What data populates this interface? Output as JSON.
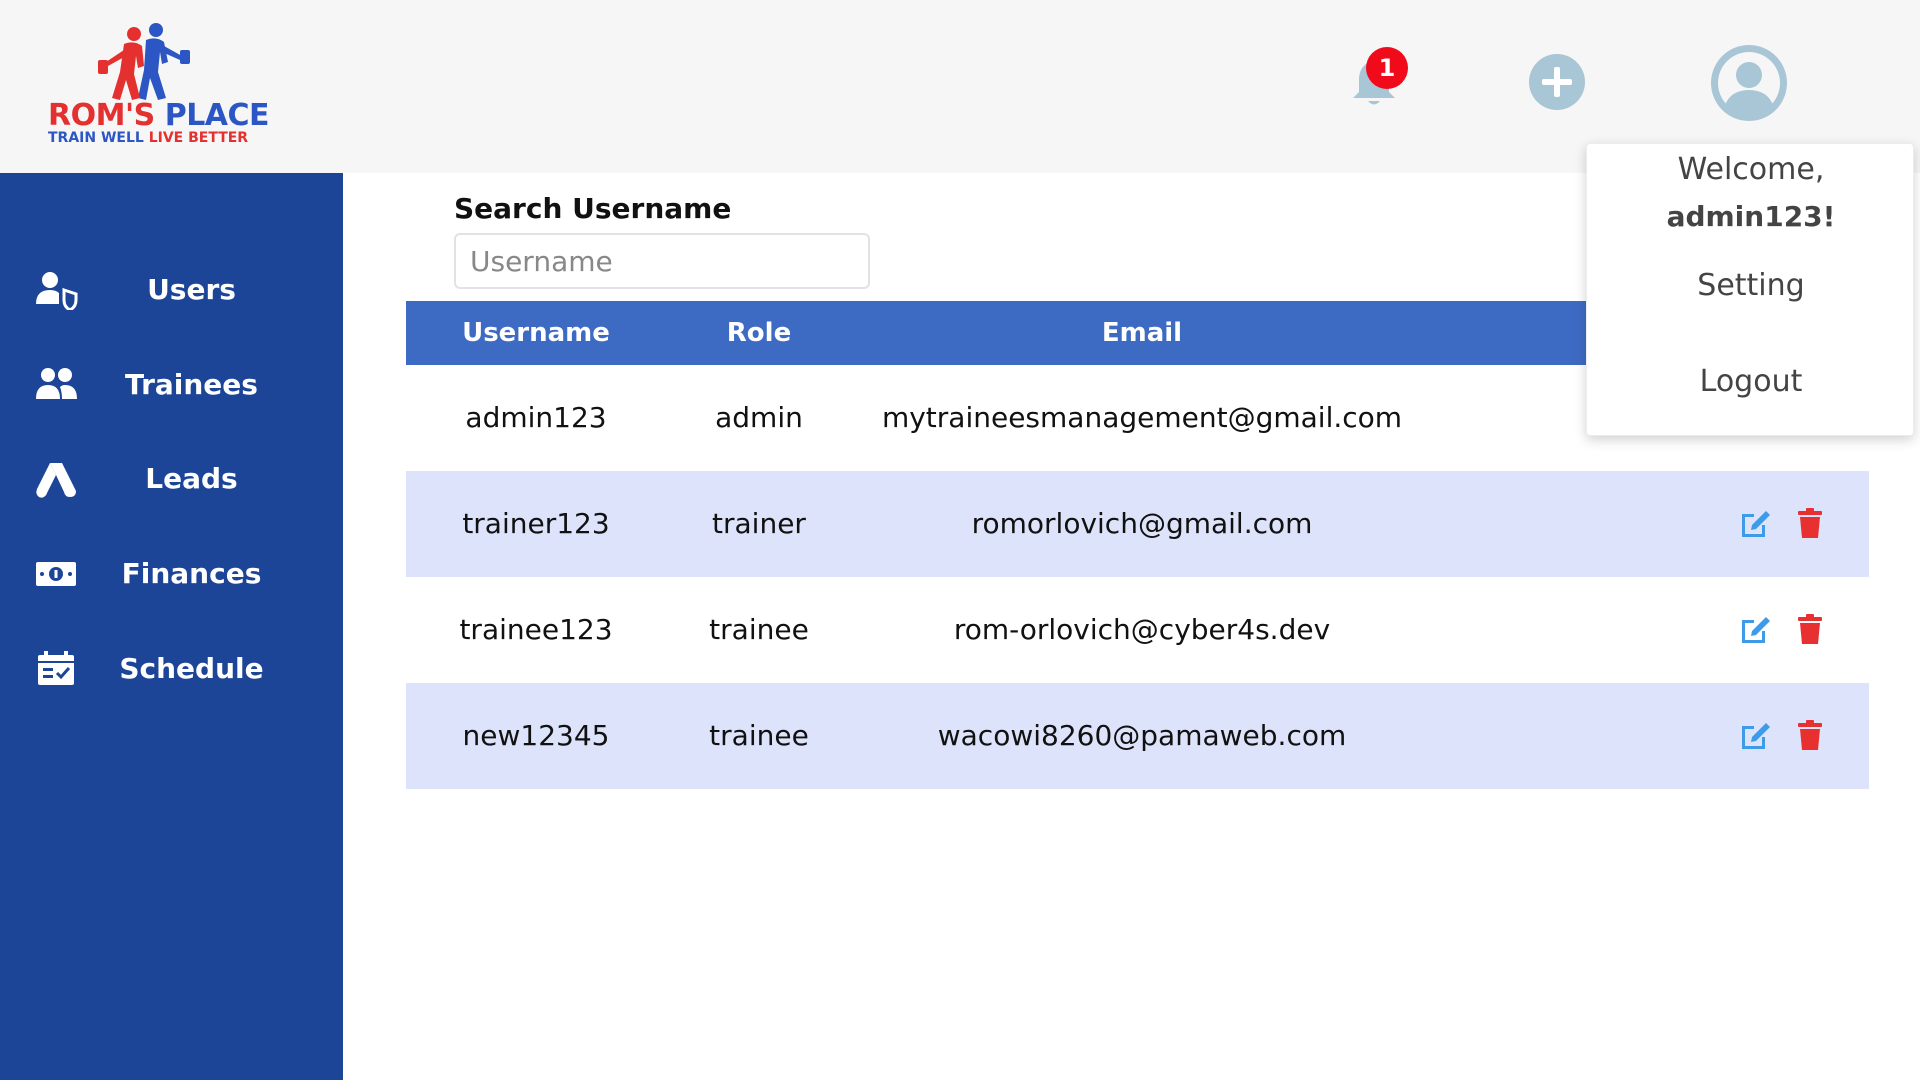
{
  "brand": {
    "name_part1": "ROM'S",
    "name_part2": "PLACE",
    "tagline_part1": "TRAIN WELL",
    "tagline_part2": "LIVE BETTER"
  },
  "header": {
    "notification_count": "1",
    "icons": [
      "bell-icon",
      "plus-circle-icon",
      "user-avatar-icon"
    ]
  },
  "sidebar": {
    "items": [
      {
        "label": "Users",
        "icon": "user-shield-icon"
      },
      {
        "label": "Trainees",
        "icon": "users-icon"
      },
      {
        "label": "Leads",
        "icon": "leads-icon"
      },
      {
        "label": "Finances",
        "icon": "money-bill-icon"
      },
      {
        "label": "Schedule",
        "icon": "calendar-check-icon"
      }
    ]
  },
  "search": {
    "label": "Search Username",
    "placeholder": "Username",
    "value": ""
  },
  "table": {
    "columns": [
      "Username",
      "Role",
      "Email"
    ],
    "rows": [
      {
        "username": "admin123",
        "role": "admin",
        "email": "mytraineesmanagement@gmail.com"
      },
      {
        "username": "trainer123",
        "role": "trainer",
        "email": "romorlovich@gmail.com"
      },
      {
        "username": "trainee123",
        "role": "trainee",
        "email": "rom-orlovich@cyber4s.dev"
      },
      {
        "username": "new12345",
        "role": "trainee",
        "email": "wacowi8260@pamaweb.com"
      }
    ]
  },
  "user_menu": {
    "welcome": "Welcome,",
    "username": "admin123!",
    "items": [
      "Setting",
      "Logout"
    ]
  },
  "colors": {
    "sidebar": "#1c4597",
    "table_header": "#3d6bc4",
    "row_alt": "#dde3fa",
    "badge": "#f00a1a",
    "edit": "#3d9be9",
    "delete": "#e83030",
    "brand_red": "#e53030",
    "brand_blue": "#2c56c4"
  }
}
